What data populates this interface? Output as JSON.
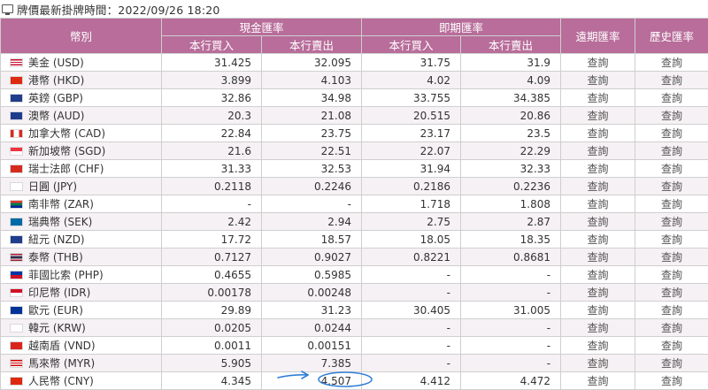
{
  "header": {
    "title": "牌價最新掛牌時間：2022/09/26 18:20"
  },
  "columns": {
    "currency": "幣別",
    "cash_group": "現金匯率",
    "spot_group": "即期匯率",
    "forward": "遠期匯率",
    "history": "歷史匯率",
    "buy": "本行買入",
    "sell": "本行賣出"
  },
  "query_label": "查詢",
  "rows": [
    {
      "name": "美金 (USD)",
      "flag": "us",
      "cash_buy": "31.425",
      "cash_sell": "32.095",
      "spot_buy": "31.75",
      "spot_sell": "31.9"
    },
    {
      "name": "港幣 (HKD)",
      "flag": "hk",
      "cash_buy": "3.899",
      "cash_sell": "4.103",
      "spot_buy": "4.02",
      "spot_sell": "4.09"
    },
    {
      "name": "英鎊 (GBP)",
      "flag": "gb",
      "cash_buy": "32.86",
      "cash_sell": "34.98",
      "spot_buy": "33.755",
      "spot_sell": "34.385"
    },
    {
      "name": "澳幣 (AUD)",
      "flag": "au",
      "cash_buy": "20.3",
      "cash_sell": "21.08",
      "spot_buy": "20.515",
      "spot_sell": "20.86"
    },
    {
      "name": "加拿大幣 (CAD)",
      "flag": "ca",
      "cash_buy": "22.84",
      "cash_sell": "23.75",
      "spot_buy": "23.17",
      "spot_sell": "23.5"
    },
    {
      "name": "新加坡幣 (SGD)",
      "flag": "sg",
      "cash_buy": "21.6",
      "cash_sell": "22.51",
      "spot_buy": "22.07",
      "spot_sell": "22.29"
    },
    {
      "name": "瑞士法郎 (CHF)",
      "flag": "ch",
      "cash_buy": "31.33",
      "cash_sell": "32.53",
      "spot_buy": "31.94",
      "spot_sell": "32.33"
    },
    {
      "name": "日圓 (JPY)",
      "flag": "jp",
      "cash_buy": "0.2118",
      "cash_sell": "0.2246",
      "spot_buy": "0.2186",
      "spot_sell": "0.2236"
    },
    {
      "name": "南非幣 (ZAR)",
      "flag": "za",
      "cash_buy": "-",
      "cash_sell": "-",
      "spot_buy": "1.718",
      "spot_sell": "1.808"
    },
    {
      "name": "瑞典幣 (SEK)",
      "flag": "se",
      "cash_buy": "2.42",
      "cash_sell": "2.94",
      "spot_buy": "2.75",
      "spot_sell": "2.87"
    },
    {
      "name": "紐元 (NZD)",
      "flag": "nz",
      "cash_buy": "17.72",
      "cash_sell": "18.57",
      "spot_buy": "18.05",
      "spot_sell": "18.35"
    },
    {
      "name": "泰幣 (THB)",
      "flag": "th",
      "cash_buy": "0.7127",
      "cash_sell": "0.9027",
      "spot_buy": "0.8221",
      "spot_sell": "0.8681"
    },
    {
      "name": "菲國比索 (PHP)",
      "flag": "ph",
      "cash_buy": "0.4655",
      "cash_sell": "0.5985",
      "spot_buy": "-",
      "spot_sell": "-"
    },
    {
      "name": "印尼幣 (IDR)",
      "flag": "id",
      "cash_buy": "0.00178",
      "cash_sell": "0.00248",
      "spot_buy": "-",
      "spot_sell": "-"
    },
    {
      "name": "歐元 (EUR)",
      "flag": "eu",
      "cash_buy": "29.89",
      "cash_sell": "31.23",
      "spot_buy": "30.405",
      "spot_sell": "31.005"
    },
    {
      "name": "韓元 (KRW)",
      "flag": "kr",
      "cash_buy": "0.0205",
      "cash_sell": "0.0244",
      "spot_buy": "-",
      "spot_sell": "-"
    },
    {
      "name": "越南盾 (VND)",
      "flag": "vn",
      "cash_buy": "0.0011",
      "cash_sell": "0.00151",
      "spot_buy": "-",
      "spot_sell": "-"
    },
    {
      "name": "馬來幣 (MYR)",
      "flag": "my",
      "cash_buy": "5.905",
      "cash_sell": "7.385",
      "spot_buy": "-",
      "spot_sell": "-"
    },
    {
      "name": "人民幣 (CNY)",
      "flag": "cn",
      "cash_buy": "4.345",
      "cash_sell": "4.507",
      "spot_buy": "4.412",
      "spot_sell": "4.472"
    }
  ],
  "colors": {
    "header_bg": "#b86d9a",
    "stripe_bg": "#f6f1f4",
    "annotation": "#2f7fd6"
  }
}
